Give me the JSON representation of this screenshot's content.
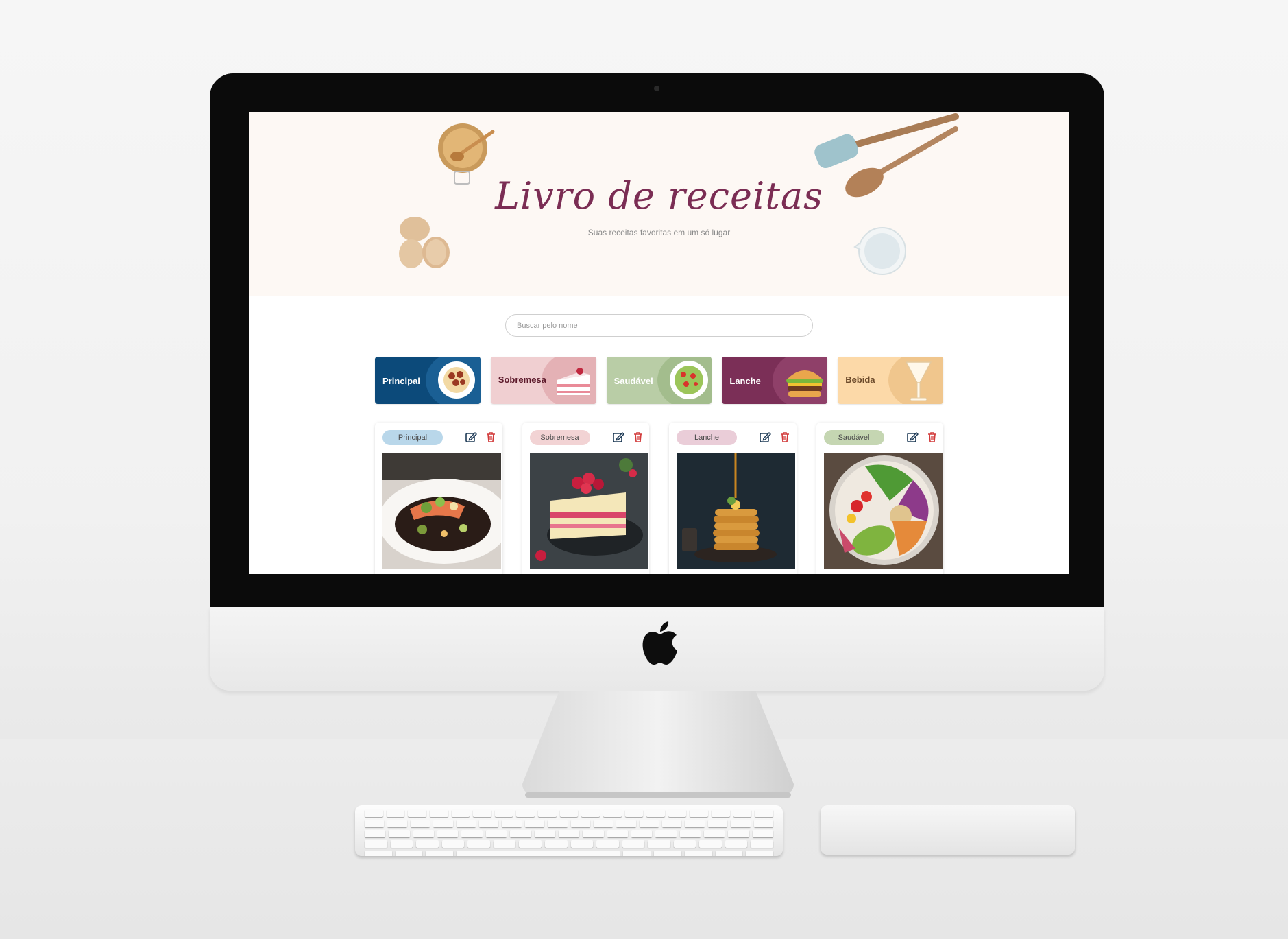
{
  "app": {
    "title": "Livro de receitas",
    "subtitle": "Suas receitas favoritas em um só lugar"
  },
  "search": {
    "placeholder": "Buscar pelo nome",
    "value": ""
  },
  "categories": [
    {
      "label": "Principal",
      "bg": "#0c4a7a",
      "accent": "#1a5f94",
      "text": "#ffffff",
      "icon": "pasta-plate-icon"
    },
    {
      "label": "Sobremesa",
      "bg": "#f0cfd1",
      "accent": "#e4b1b5",
      "text": "#5c1a2b",
      "icon": "cake-slice-icon"
    },
    {
      "label": "Saudável",
      "bg": "#b9cda6",
      "accent": "#a3bd8d",
      "text": "#ffffff",
      "icon": "salad-plate-icon"
    },
    {
      "label": "Lanche",
      "bg": "#7b2f57",
      "accent": "#8f4069",
      "text": "#ffffff",
      "icon": "burger-icon"
    },
    {
      "label": "Bebida",
      "bg": "#fcd9a8",
      "accent": "#f0c68d",
      "text": "#6b4a2a",
      "icon": "cocktail-glass-icon"
    }
  ],
  "recipes": [
    {
      "category": "Principal",
      "badge_color": "#b9d7ea",
      "photo": "salmon-dish-photo"
    },
    {
      "category": "Sobremesa",
      "badge_color": "#f2d3d4",
      "photo": "raspberry-cake-photo"
    },
    {
      "category": "Lanche",
      "badge_color": "#eacdd8",
      "photo": "pancake-stack-photo"
    },
    {
      "category": "Saudável",
      "badge_color": "#c5d6b2",
      "photo": "healthy-bowl-photo"
    }
  ],
  "actions": {
    "edit_icon": "edit-icon",
    "delete_icon": "trash-icon",
    "edit_color": "#1f3b57",
    "delete_color": "#d23a3a"
  },
  "colors": {
    "hero_bg": "#fdf8f4",
    "title": "#7b2d54"
  }
}
